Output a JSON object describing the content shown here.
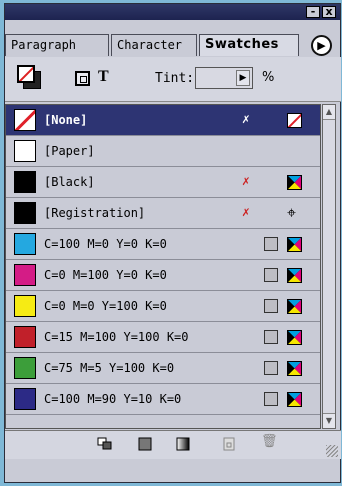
{
  "panel": {
    "window_buttons": {
      "minimize": "-",
      "close": "x"
    }
  },
  "tabs": [
    {
      "label": "Paragraph",
      "active": false
    },
    {
      "label": "Character",
      "active": false
    },
    {
      "label": "Swatches",
      "active": true
    }
  ],
  "menu_button_glyph": "▶",
  "toolbar": {
    "tint_label": "Tint:",
    "tint_value": "",
    "tint_unit": "%",
    "text_mode_glyph": "T"
  },
  "swatches": [
    {
      "name": "[None]",
      "color": "none",
      "nonedit": true,
      "mode": "none",
      "selected": true
    },
    {
      "name": "[Paper]",
      "color": "#ffffff",
      "nonedit": false,
      "mode": "",
      "selected": false
    },
    {
      "name": "[Black]",
      "color": "#000000",
      "nonedit": true,
      "mode": "cmyk",
      "selected": false
    },
    {
      "name": "[Registration]",
      "color": "#000000",
      "nonedit": true,
      "mode": "registration",
      "selected": false
    },
    {
      "name": "C=100 M=0 Y=0 K=0",
      "color": "#24a8e0",
      "nonedit": false,
      "mode": "cmyk",
      "selected": false
    },
    {
      "name": "C=0 M=100 Y=0 K=0",
      "color": "#d41c86",
      "nonedit": false,
      "mode": "cmyk",
      "selected": false
    },
    {
      "name": "C=0 M=0 Y=100 K=0",
      "color": "#f6eb14",
      "nonedit": false,
      "mode": "cmyk",
      "selected": false
    },
    {
      "name": "C=15 M=100 Y=100 K=0",
      "color": "#c1202a",
      "nonedit": false,
      "mode": "cmyk",
      "selected": false
    },
    {
      "name": "C=75 M=5 Y=100 K=0",
      "color": "#3c9e3a",
      "nonedit": false,
      "mode": "cmyk",
      "selected": false
    },
    {
      "name": "C=100 M=90 Y=10 K=0",
      "color": "#2c2a86",
      "nonedit": false,
      "mode": "cmyk",
      "selected": false
    }
  ],
  "glyphs": {
    "nonedit": "✗",
    "registration": "⌖",
    "trash": "🗑"
  },
  "colors": {
    "selection": "#2d3473",
    "none_slash": "#e0202a",
    "titlebar": "#2f3766"
  }
}
